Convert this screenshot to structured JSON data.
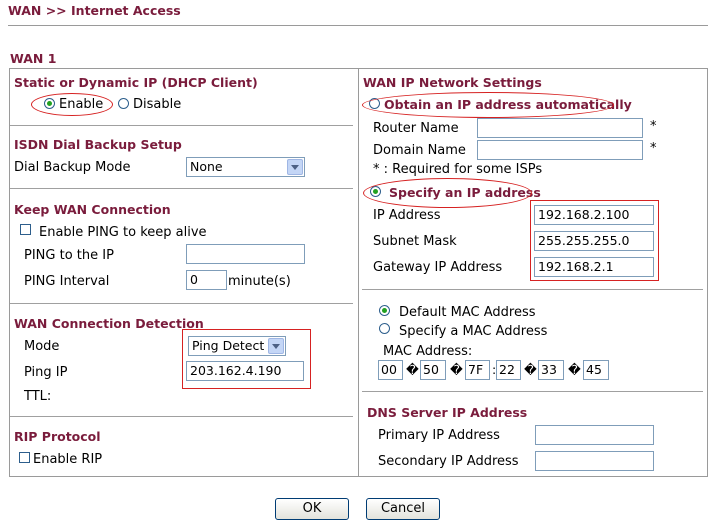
{
  "breadcrumb": "WAN >> Internet Access",
  "section_title": "WAN 1",
  "left": {
    "static_dynamic": {
      "heading": "Static or Dynamic IP (DHCP Client)",
      "enable_label": "Enable",
      "disable_label": "Disable",
      "selected": "Enable"
    },
    "isdn": {
      "heading": "ISDN Dial Backup Setup",
      "mode_label": "Dial Backup Mode",
      "mode_value": "None"
    },
    "keep_wan": {
      "heading": "Keep WAN Connection",
      "enable_ping_label": "Enable PING to keep alive",
      "ping_to_ip_label": "PING to the IP",
      "ping_to_ip_value": "",
      "ping_interval_label": "PING Interval",
      "ping_interval_value": "0",
      "ping_interval_unit": "minute(s)"
    },
    "detection": {
      "heading": "WAN Connection Detection",
      "mode_label": "Mode",
      "mode_value": "Ping Detect",
      "ping_ip_label": "Ping IP",
      "ping_ip_value": "203.162.4.190",
      "ttl_label": "TTL:"
    },
    "rip": {
      "heading": "RIP Protocol",
      "enable_label": "Enable RIP"
    }
  },
  "right": {
    "wan_ip": {
      "heading": "WAN IP Network Settings",
      "obtain_label": "Obtain an IP address automatically",
      "router_name_label": "Router Name",
      "domain_name_label": "Domain Name",
      "required_star": "*",
      "required_note": "* : Required for some ISPs",
      "specify_label": "Specify an IP address",
      "selected": "Specify an IP address",
      "ip_label": "IP Address",
      "ip_value": "192.168.2.100",
      "subnet_label": "Subnet Mask",
      "subnet_value": "255.255.255.0",
      "gateway_label": "Gateway IP Address",
      "gateway_value": "192.168.2.1"
    },
    "mac": {
      "default_label": "Default MAC Address",
      "specify_label": "Specify a MAC Address",
      "selected": "Default MAC Address",
      "mac_label": "MAC Address:",
      "octets": [
        "00",
        "50",
        "7F",
        "22",
        "33",
        "45"
      ],
      "separators": [
        "�",
        "�",
        ":",
        "�",
        "�"
      ]
    },
    "dns": {
      "heading": "DNS Server IP Address",
      "primary_label": "Primary IP Address",
      "secondary_label": "Secondary IP Address"
    }
  },
  "buttons": {
    "ok": "OK",
    "cancel": "Cancel"
  },
  "colors": {
    "heading": "#7a1c3c",
    "highlight": "#d62222",
    "radio_checked": "#21a121"
  }
}
